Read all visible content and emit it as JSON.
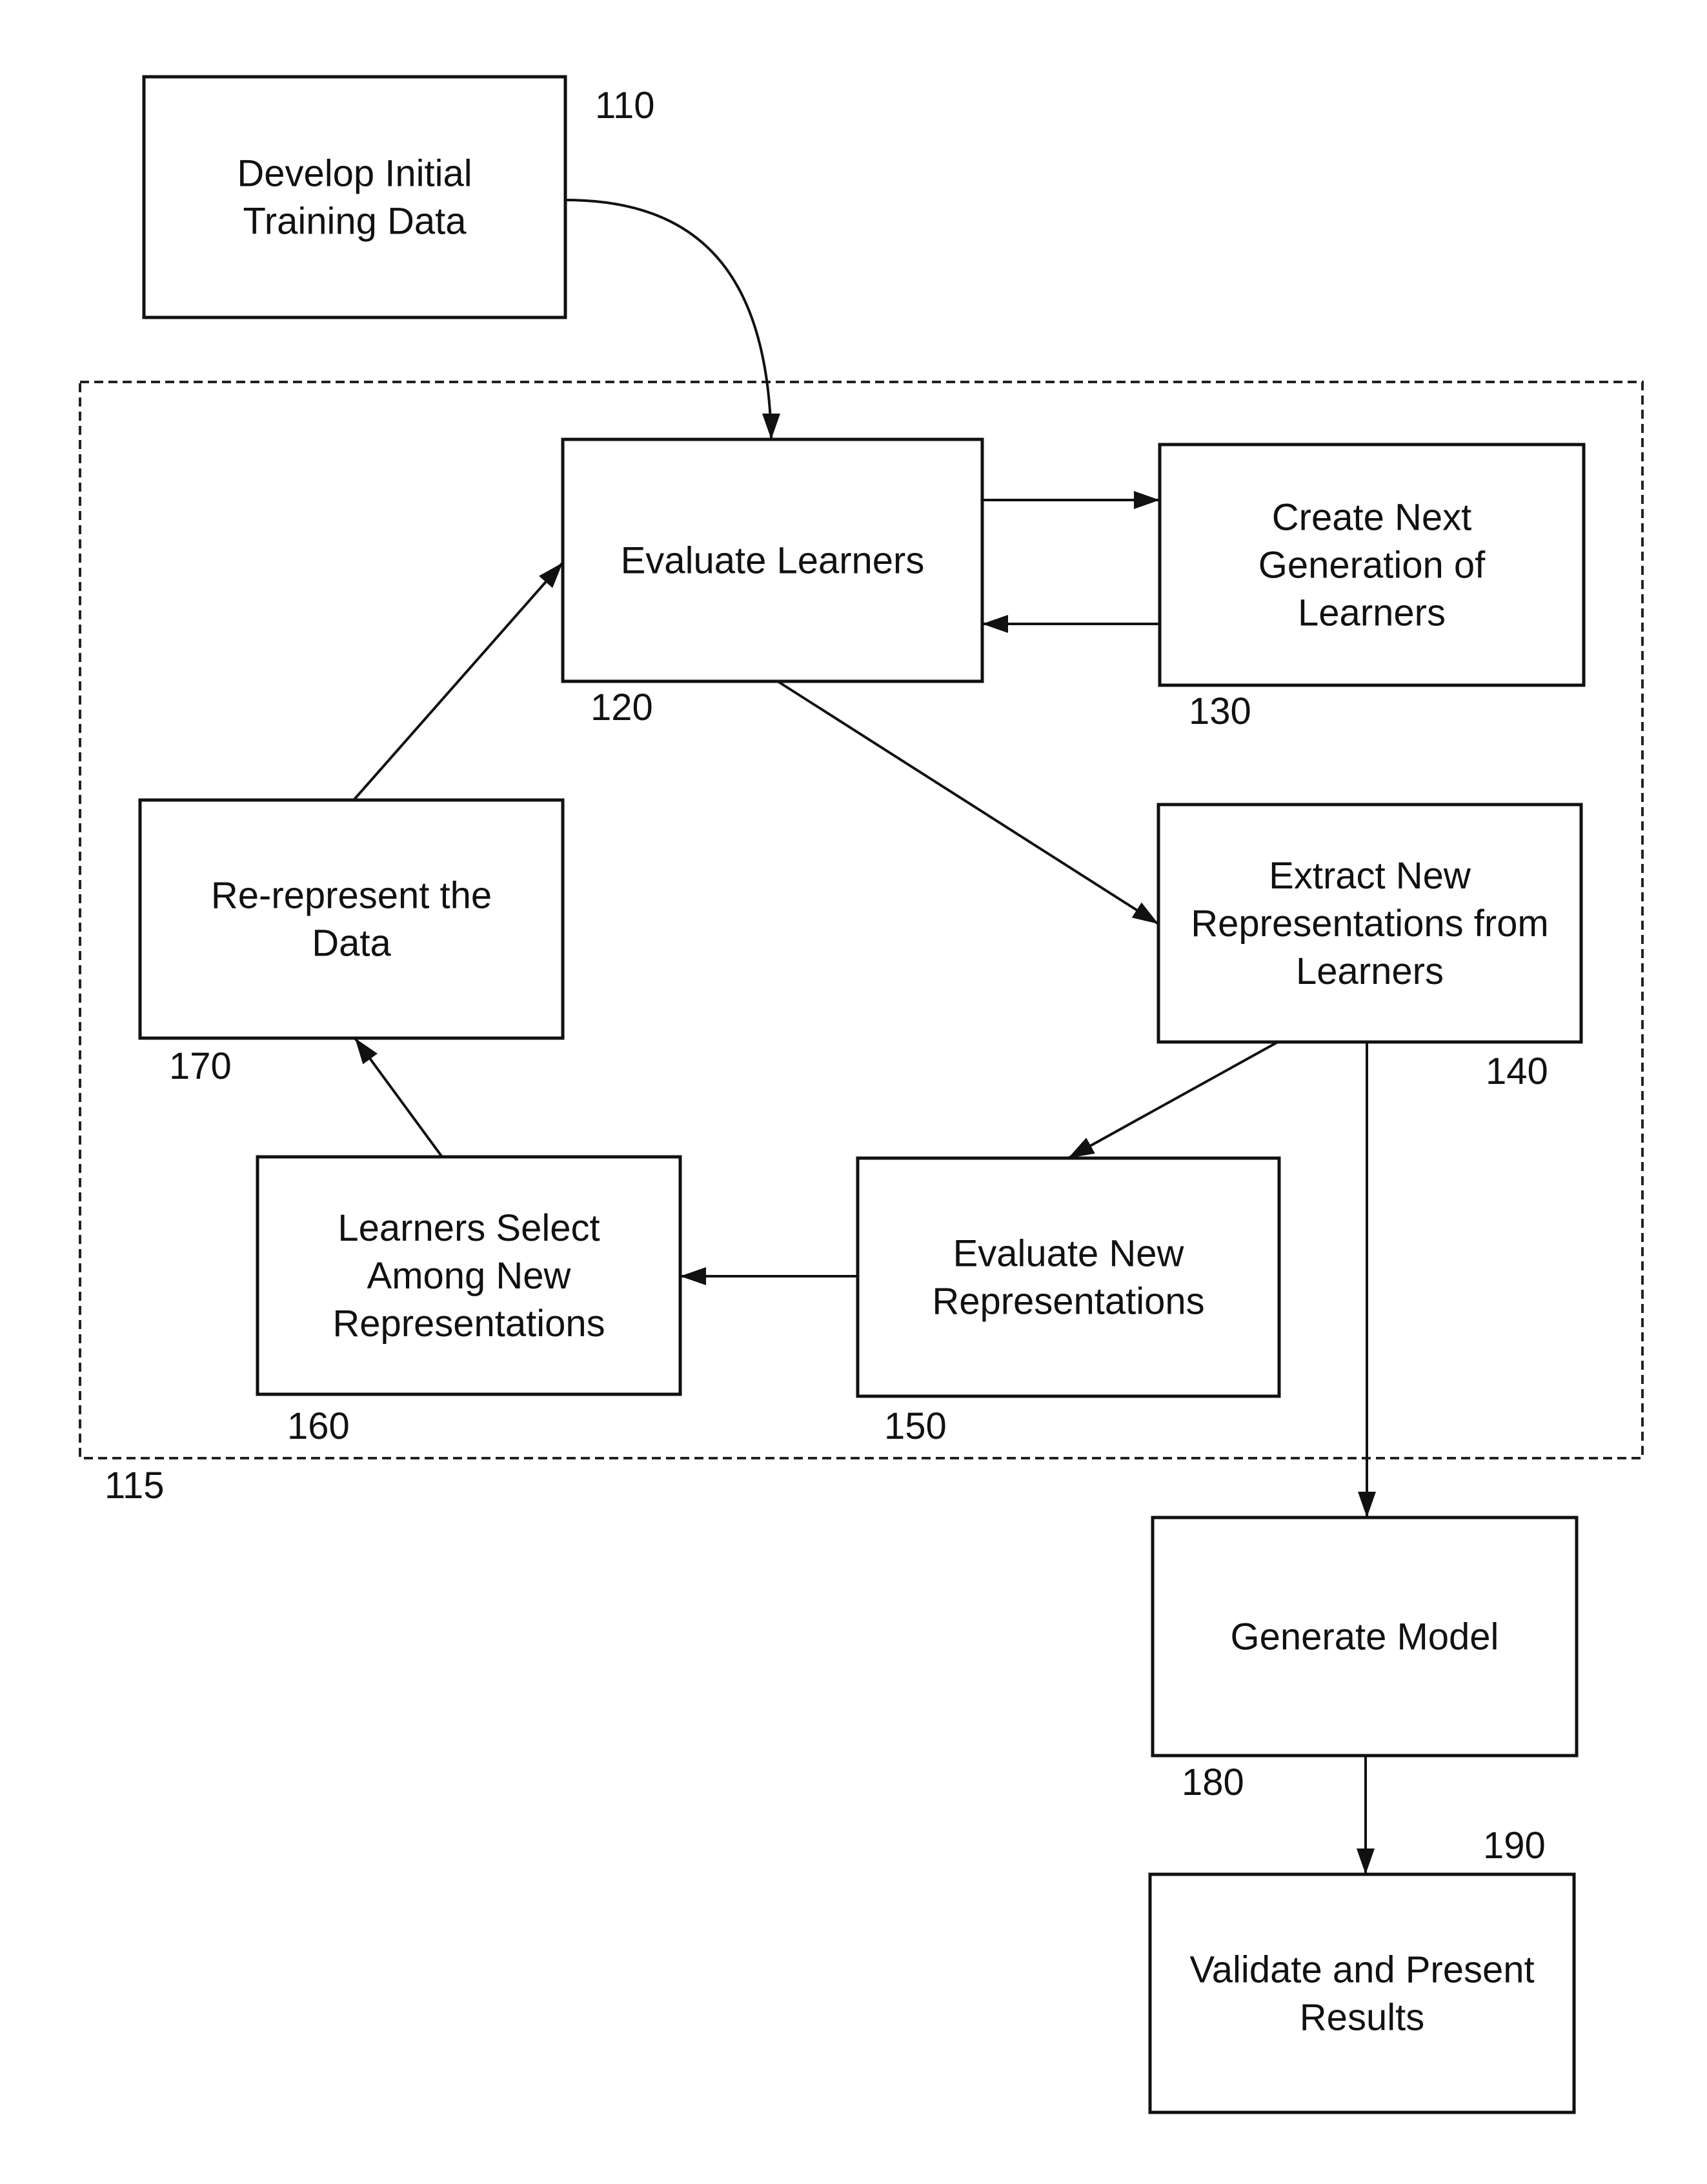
{
  "diagram": {
    "type": "flowchart",
    "container": {
      "id": "115",
      "label": "115",
      "style": "dashed"
    },
    "nodes": [
      {
        "id": "110",
        "ref": "110",
        "lines": [
          "Develop Initial",
          "Training Data"
        ]
      },
      {
        "id": "120",
        "ref": "120",
        "lines": [
          "Evaluate Learners"
        ]
      },
      {
        "id": "130",
        "ref": "130",
        "lines": [
          "Create Next",
          "Generation of",
          "Learners"
        ]
      },
      {
        "id": "140",
        "ref": "140",
        "lines": [
          "Extract New",
          "Representations from",
          "Learners"
        ]
      },
      {
        "id": "150",
        "ref": "150",
        "lines": [
          "Evaluate New",
          "Representations"
        ]
      },
      {
        "id": "160",
        "ref": "160",
        "lines": [
          "Learners Select",
          "Among New",
          "Representations"
        ]
      },
      {
        "id": "170",
        "ref": "170",
        "lines": [
          "Re-represent the",
          "Data"
        ]
      },
      {
        "id": "180",
        "ref": "180",
        "lines": [
          "Generate Model"
        ]
      },
      {
        "id": "190",
        "ref": "190",
        "lines": [
          "Validate and Present",
          "Results"
        ]
      }
    ],
    "edges": [
      {
        "from": "110",
        "to": "120"
      },
      {
        "from": "120",
        "to": "130"
      },
      {
        "from": "130",
        "to": "120"
      },
      {
        "from": "120",
        "to": "140"
      },
      {
        "from": "140",
        "to": "150"
      },
      {
        "from": "140",
        "to": "180"
      },
      {
        "from": "150",
        "to": "160"
      },
      {
        "from": "160",
        "to": "170"
      },
      {
        "from": "170",
        "to": "120"
      },
      {
        "from": "180",
        "to": "190"
      }
    ]
  }
}
